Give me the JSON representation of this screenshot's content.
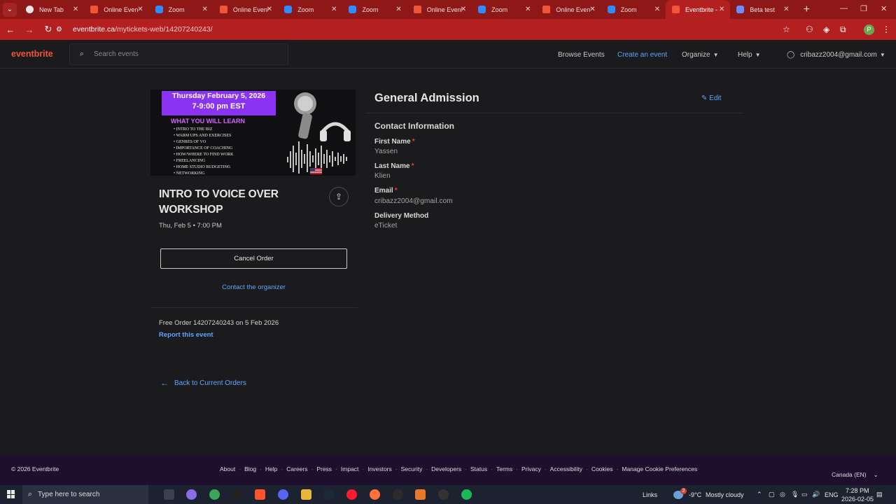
{
  "browser": {
    "tabs": [
      {
        "label": "New Tab",
        "icon": "chrome-icon",
        "active": false
      },
      {
        "label": "Online Events",
        "icon": "eventbrite-icon",
        "active": false
      },
      {
        "label": "Zoom",
        "icon": "zoom-icon",
        "active": false
      },
      {
        "label": "Online Events",
        "icon": "eventbrite-icon",
        "active": false
      },
      {
        "label": "Zoom",
        "icon": "zoom-icon",
        "active": false
      },
      {
        "label": "Zoom",
        "icon": "zoom-icon",
        "active": false
      },
      {
        "label": "Online Events",
        "icon": "eventbrite-icon",
        "active": false
      },
      {
        "label": "Zoom",
        "icon": "zoom-icon",
        "active": false
      },
      {
        "label": "Online Events",
        "icon": "eventbrite-icon",
        "active": false
      },
      {
        "label": "Zoom",
        "icon": "zoom-icon",
        "active": false
      },
      {
        "label": "Eventbrite -",
        "icon": "eventbrite-icon",
        "active": true
      },
      {
        "label": "Beta test",
        "icon": "zoom-icon",
        "active": false
      }
    ],
    "url_host": "eventbrite.ca",
    "url_path": "/mytickets-web/14207240243/",
    "profile_initial": "P"
  },
  "header": {
    "logo": "eventbrite",
    "search_placeholder": "Search events",
    "nav": {
      "browse": "Browse Events",
      "create": "Create an event",
      "organize": "Organize",
      "help": "Help",
      "account": "cribazz2004@gmail.com"
    }
  },
  "event": {
    "image": {
      "date_line1": "Thursday February 5, 2026",
      "date_line2": "7-9:00 pm EST",
      "learn_heading": "WHAT YOU WILL LEARN",
      "topics": [
        "INTRO TO THE BIZ",
        "WARM UPS AND EXERCISES",
        "GENRES OF VO",
        "IMPORTANCE OF COACHING",
        "HOW/WHERE TO FIND WORK",
        "FREELANCING",
        "HOME STUDIO BUDGETING",
        "NETWORKING"
      ]
    },
    "title": "INTRO TO VOICE OVER WORKSHOP",
    "when": "Thu, Feb 5 • 7:00 PM",
    "cancel_label": "Cancel Order",
    "contact_label": "Contact the organizer",
    "order_line": "Free Order 14207240243 on 5 Feb 2026",
    "report_label": "Report this event",
    "back_label": "Back to Current Orders"
  },
  "ticket": {
    "title": "General Admission",
    "edit_label": "Edit",
    "section": "Contact Information",
    "fields": [
      {
        "label": "First Name",
        "required": "*",
        "value": "Yassen"
      },
      {
        "label": "Last Name",
        "required": "*",
        "value": "Klien"
      },
      {
        "label": "Email",
        "required": "*",
        "value": "cribazz2004@gmail.com"
      },
      {
        "label": "Delivery Method",
        "required": "",
        "value": "eTicket"
      }
    ]
  },
  "footer": {
    "copyright": "© 2026 Eventbrite",
    "links": [
      "About",
      "Blog",
      "Help",
      "Careers",
      "Press",
      "Impact",
      "Investors",
      "Security",
      "Developers",
      "Status",
      "Terms",
      "Privacy",
      "Accessibility",
      "Cookies",
      "Manage Cookie Preferences"
    ],
    "locale": "Canada (EN)"
  },
  "taskbar": {
    "search_placeholder": "Type here to search",
    "links_label": "Links",
    "weather_badge": "2",
    "temperature": "-9°C",
    "weather": "Mostly cloudy",
    "language": "ENG",
    "time": "7:28 PM",
    "date": "2026-02-05"
  },
  "colors": {
    "browser_frame": "#8e1717",
    "eventbrite_orange": "#f05537",
    "link_blue": "#5ba7ff",
    "footer_bg": "#1f0f2f",
    "page_bg": "#1b1b1d"
  }
}
